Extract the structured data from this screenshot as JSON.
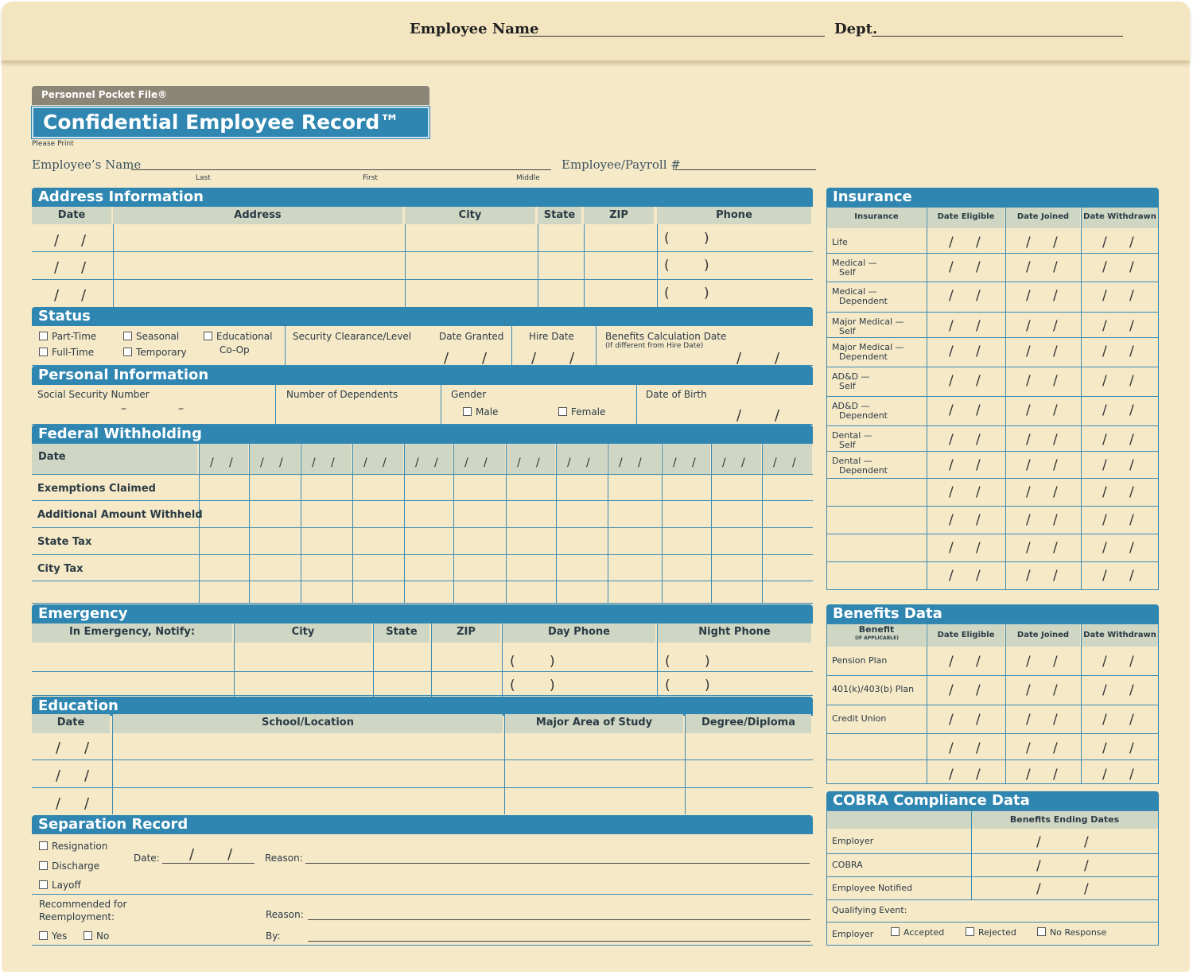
{
  "tab": {
    "employee_name_label": "Employee Name",
    "dept_label": "Dept."
  },
  "brand": {
    "subtitle": "Personnel Pocket File®",
    "title": "Confidential Employee Record™",
    "please_print": "Please Print"
  },
  "name_row": {
    "employee_name": "Employee’s Name",
    "last": "Last",
    "first": "First",
    "middle": "Middle",
    "payroll": "Employee/Payroll #"
  },
  "address": {
    "title": "Address Information",
    "headers": [
      "Date",
      "Address",
      "City",
      "State",
      "ZIP",
      "Phone"
    ]
  },
  "status": {
    "title": "Status",
    "part_time": "Part-Time",
    "full_time": "Full-Time",
    "seasonal": "Seasonal",
    "temporary": "Temporary",
    "educational": "Educational",
    "coop": "Co-Op",
    "security": "Security Clearance/Level",
    "date_granted": "Date Granted",
    "hire_date": "Hire Date",
    "benefits_calc": "Benefits Calculation Date",
    "benefits_calc_note": "(If different from Hire Date)"
  },
  "personal": {
    "title": "Personal Information",
    "ssn": "Social Security Number",
    "dependents": "Number of Dependents",
    "gender": "Gender",
    "male": "Male",
    "female": "Female",
    "dob": "Date of Birth"
  },
  "federal": {
    "title": "Federal Withholding",
    "rows": [
      "Date",
      "Exemptions Claimed",
      "Additional Amount Withheld",
      "State Tax",
      "City Tax"
    ]
  },
  "emergency": {
    "title": "Emergency",
    "headers": [
      "In Emergency, Notify:",
      "City",
      "State",
      "ZIP",
      "Day Phone",
      "Night Phone"
    ]
  },
  "education": {
    "title": "Education",
    "headers": [
      "Date",
      "School/Location",
      "Major Area of Study",
      "Degree/Diploma"
    ]
  },
  "separation": {
    "title": "Separation Record",
    "resignation": "Resignation",
    "discharge": "Discharge",
    "layoff": "Layoff",
    "date": "Date:",
    "reason": "Reason:",
    "recommended": "Recommended for",
    "reemployment": "Reemployment:",
    "yes": "Yes",
    "no": "No",
    "reason2": "Reason:",
    "by": "By:"
  },
  "insurance": {
    "title": "Insurance",
    "headers": [
      "Insurance",
      "Date Eligible",
      "Date Joined",
      "Date Withdrawn"
    ],
    "rows": [
      [
        "Life",
        ""
      ],
      [
        "Medical —",
        "Self"
      ],
      [
        "Medical —",
        "Dependent"
      ],
      [
        "Major Medical —",
        "Self"
      ],
      [
        "Major Medical —",
        "Dependent"
      ],
      [
        "AD&D —",
        "Self"
      ],
      [
        "AD&D —",
        "Dependent"
      ],
      [
        "Dental —",
        "Self"
      ],
      [
        "Dental —",
        "Dependent"
      ],
      [
        "",
        ""
      ],
      [
        "",
        ""
      ],
      [
        "",
        ""
      ],
      [
        "",
        ""
      ]
    ]
  },
  "benefits": {
    "title": "Benefits Data",
    "headers": [
      "Benefit",
      "(IF APPLICABLE)",
      "Date Eligible",
      "Date Joined",
      "Date Withdrawn"
    ],
    "rows": [
      "Pension Plan",
      "401(k)/403(b) Plan",
      "Credit Union",
      "",
      ""
    ]
  },
  "cobra": {
    "title": "COBRA Compliance Data",
    "header": "Benefits Ending Dates",
    "rows": [
      "Employer",
      "COBRA",
      "Employee Notified"
    ],
    "qualifying": "Qualifying Event:",
    "employer": "Employer",
    "accepted": "Accepted",
    "rejected": "Rejected",
    "no_response": "No Response"
  },
  "colors": {
    "accent": "#2f86b0",
    "background": "#f6e9c8",
    "header": "#cfd6c4"
  }
}
